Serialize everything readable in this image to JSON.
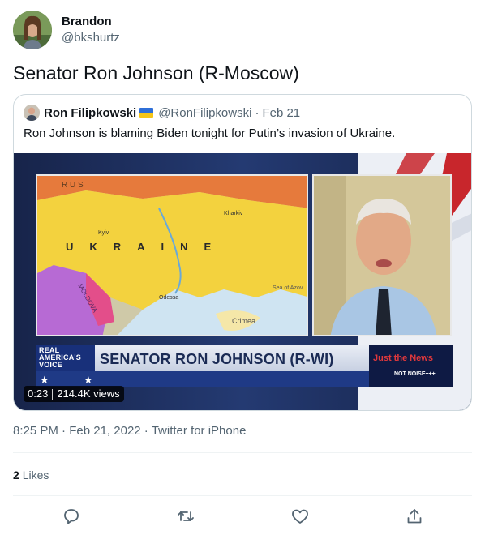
{
  "tweet": {
    "author_name": "Brandon",
    "author_handle": "@bkshurtz",
    "text": "Senator Ron Johnson (R-Moscow)",
    "timestamp": "8:25 PM",
    "date": "Feb 21, 2022",
    "source": "Twitter for iPhone",
    "like_count": "2",
    "likes_label": "Likes"
  },
  "quoted": {
    "author_name": "Ron Filipkowski",
    "flag_icon": "ukraine-flag-icon",
    "author_handle": "@RonFilipkowski",
    "separator": "·",
    "date": "Feb 21",
    "text": "Ron Johnson is blaming Biden tonight for Putin’s invasion of Ukraine."
  },
  "video": {
    "timestamp": "0:23",
    "views": "214.4K views",
    "chyron": "SENATOR RON JOHNSON (R-WI)",
    "network_line1": "REAL",
    "network_line2": "AMERICA'S",
    "network_line3": "VOICE",
    "bug_main": "Just the News",
    "bug_sub": "NOT NOISE+++",
    "map_title": "UKRAINE",
    "map_labels": [
      "R U S",
      "Kyiv",
      "Kharkiv",
      "Odessa",
      "Crimea",
      "Sea of Azov",
      "MOLDOVA"
    ]
  },
  "actions": [
    {
      "icon": "reply-icon"
    },
    {
      "icon": "retweet-icon"
    },
    {
      "icon": "like-icon"
    },
    {
      "icon": "share-icon"
    }
  ],
  "colors": {
    "text_primary": "#0f1419",
    "text_secondary": "#536471",
    "border": "#cfd9de",
    "divider": "#eff3f4"
  }
}
